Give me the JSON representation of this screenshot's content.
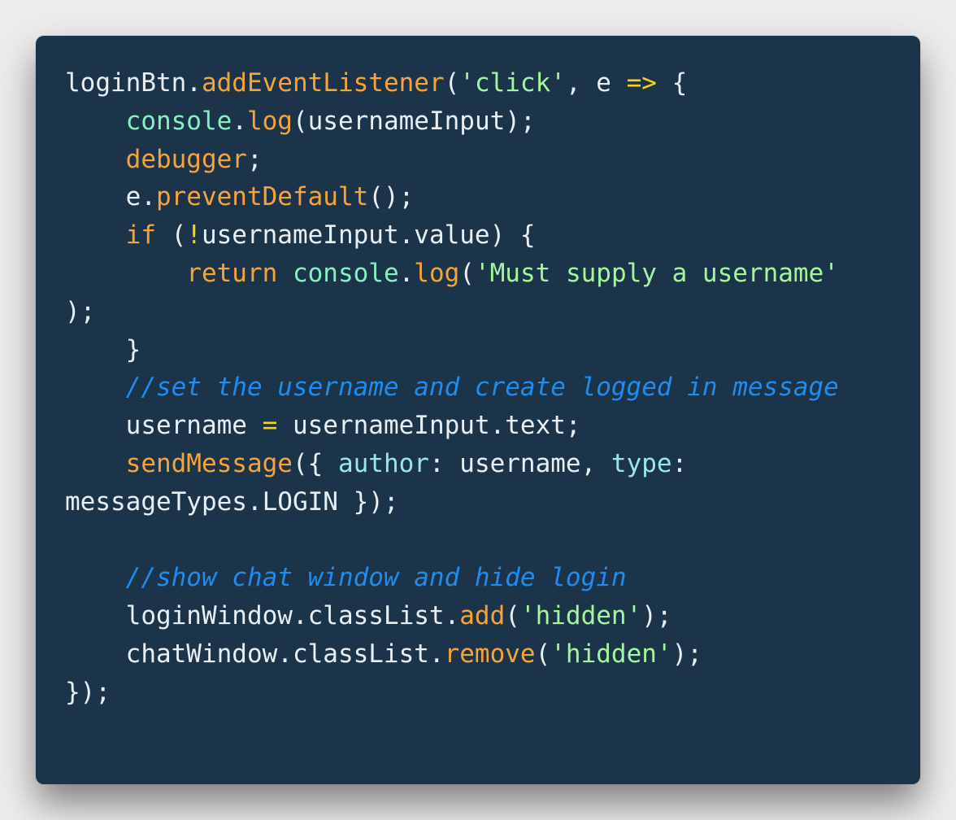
{
  "colors": {
    "page_background": "#ececec",
    "editor_background": "#1b3449",
    "plain": "#e8eef2",
    "function": "#f7a33a",
    "keyword": "#f7a33a",
    "string": "#a5f59c",
    "operator": "#f7d21a",
    "builtin": "#88f0c0",
    "property": "#9ae6f0",
    "comment": "#1f8cf0"
  },
  "code": {
    "lines": [
      [
        {
          "t": "plain",
          "v": "loginBtn."
        },
        {
          "t": "func",
          "v": "addEventListener"
        },
        {
          "t": "plain",
          "v": "("
        },
        {
          "t": "str",
          "v": "'click'"
        },
        {
          "t": "plain",
          "v": ", e "
        },
        {
          "t": "op",
          "v": "=>"
        },
        {
          "t": "plain",
          "v": " {"
        }
      ],
      [
        {
          "t": "plain",
          "v": "    "
        },
        {
          "t": "builtin",
          "v": "console"
        },
        {
          "t": "plain",
          "v": "."
        },
        {
          "t": "func",
          "v": "log"
        },
        {
          "t": "plain",
          "v": "(usernameInput);"
        }
      ],
      [
        {
          "t": "plain",
          "v": "    "
        },
        {
          "t": "kw",
          "v": "debugger"
        },
        {
          "t": "plain",
          "v": ";"
        }
      ],
      [
        {
          "t": "plain",
          "v": "    e."
        },
        {
          "t": "func",
          "v": "preventDefault"
        },
        {
          "t": "plain",
          "v": "();"
        }
      ],
      [
        {
          "t": "plain",
          "v": "    "
        },
        {
          "t": "kw",
          "v": "if"
        },
        {
          "t": "plain",
          "v": " ("
        },
        {
          "t": "op",
          "v": "!"
        },
        {
          "t": "plain",
          "v": "usernameInput.value) {"
        }
      ],
      [
        {
          "t": "plain",
          "v": "        "
        },
        {
          "t": "kw",
          "v": "return"
        },
        {
          "t": "plain",
          "v": " "
        },
        {
          "t": "builtin",
          "v": "console"
        },
        {
          "t": "plain",
          "v": "."
        },
        {
          "t": "func",
          "v": "log"
        },
        {
          "t": "plain",
          "v": "("
        },
        {
          "t": "str",
          "v": "'Must supply a username'"
        }
      ],
      [
        {
          "t": "plain",
          "v": ");"
        }
      ],
      [
        {
          "t": "plain",
          "v": "    }"
        }
      ],
      [
        {
          "t": "plain",
          "v": "    "
        },
        {
          "t": "comment",
          "v": "//set the username and create logged in message"
        }
      ],
      [
        {
          "t": "plain",
          "v": "    username "
        },
        {
          "t": "op",
          "v": "="
        },
        {
          "t": "plain",
          "v": " usernameInput.text;"
        }
      ],
      [
        {
          "t": "plain",
          "v": "    "
        },
        {
          "t": "func",
          "v": "sendMessage"
        },
        {
          "t": "plain",
          "v": "({ "
        },
        {
          "t": "prop",
          "v": "author"
        },
        {
          "t": "plain",
          "v": ": username, "
        },
        {
          "t": "prop",
          "v": "type"
        },
        {
          "t": "plain",
          "v": ":"
        }
      ],
      [
        {
          "t": "plain",
          "v": "messageTypes.LOGIN });"
        }
      ],
      [
        {
          "t": "plain",
          "v": ""
        }
      ],
      [
        {
          "t": "plain",
          "v": "    "
        },
        {
          "t": "comment",
          "v": "//show chat window and hide login"
        }
      ],
      [
        {
          "t": "plain",
          "v": "    loginWindow.classList."
        },
        {
          "t": "func",
          "v": "add"
        },
        {
          "t": "plain",
          "v": "("
        },
        {
          "t": "str",
          "v": "'hidden'"
        },
        {
          "t": "plain",
          "v": ");"
        }
      ],
      [
        {
          "t": "plain",
          "v": "    chatWindow.classList."
        },
        {
          "t": "func",
          "v": "remove"
        },
        {
          "t": "plain",
          "v": "("
        },
        {
          "t": "str",
          "v": "'hidden'"
        },
        {
          "t": "plain",
          "v": ");"
        }
      ],
      [
        {
          "t": "plain",
          "v": "});"
        }
      ]
    ]
  }
}
